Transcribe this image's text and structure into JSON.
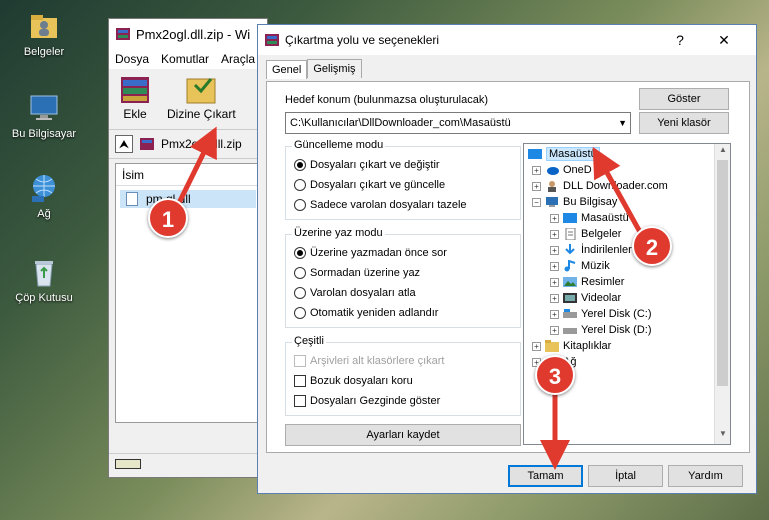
{
  "desktop": {
    "icons": [
      {
        "label": "Belgeler",
        "icon": "folder-user-icon"
      },
      {
        "label": "Bu Bilgisayar",
        "icon": "computer-icon"
      },
      {
        "label": "Ağ",
        "icon": "network-icon"
      },
      {
        "label": "Çöp Kutusu",
        "icon": "recycle-bin-icon"
      }
    ]
  },
  "winrar": {
    "title": "Pmx2ogl.dll.zip - Wi",
    "menu": [
      "Dosya",
      "Komutlar",
      "Araçla"
    ],
    "toolbar": {
      "add_label": "Ekle",
      "extract_label": "Dizine Çıkart"
    },
    "path": "Pmx2ogl.dll.zip",
    "column_name": "İsim",
    "file": "pmx2ogl.dll",
    "file_visible": "pm    gl.dll"
  },
  "dialog": {
    "title": "Çıkartma yolu ve seçenekleri",
    "help": "?",
    "close": "✕",
    "tabs": [
      "Genel",
      "Gelişmiş"
    ],
    "dest_label": "Hedef konum (bulunmazsa oluşturulacak)",
    "dest_value": "C:\\Kullanıcılar\\DllDownloader_com\\Masaüstü",
    "show_button": "Göster",
    "new_folder_button": "Yeni klasör",
    "update_mode": {
      "title": "Güncelleme modu",
      "options": [
        "Dosyaları çıkart ve değiştir",
        "Dosyaları çıkart ve güncelle",
        "Sadece varolan dosyaları tazele"
      ],
      "selected": 0
    },
    "overwrite_mode": {
      "title": "Üzerine yaz modu",
      "options": [
        "Üzerine yazmadan önce sor",
        "Sormadan üzerine yaz",
        "Varolan dosyaları atla",
        "Otomatik yeniden adlandır"
      ],
      "selected": 0
    },
    "misc": {
      "title": "Çeşitli",
      "options": [
        "Arşivleri alt klasörlere çıkart",
        "Bozuk dosyaları koru",
        "Dosyaları Gezginde göster"
      ]
    },
    "save_settings": "Ayarları kaydet",
    "tree": [
      {
        "label": "Masaüstü",
        "icon": "desktop-folder-icon",
        "level": 0,
        "selected": true
      },
      {
        "label": "OneD",
        "icon": "onedrive-icon",
        "level": 1
      },
      {
        "label": "DLL Downloader.com",
        "icon": "user-icon",
        "level": 1
      },
      {
        "label": "Bu Bilgisay",
        "icon": "computer-icon",
        "level": 1,
        "expanded": true
      },
      {
        "label": "Masaüstü",
        "icon": "desktop-folder-icon",
        "level": 2
      },
      {
        "label": "Belgeler",
        "icon": "documents-icon",
        "level": 2
      },
      {
        "label": "İndirilenler",
        "icon": "downloads-icon",
        "level": 2
      },
      {
        "label": "Müzik",
        "icon": "music-icon",
        "level": 2
      },
      {
        "label": "Resimler",
        "icon": "pictures-icon",
        "level": 2
      },
      {
        "label": "Videolar",
        "icon": "videos-icon",
        "level": 2
      },
      {
        "label": "Yerel Disk (C:)",
        "icon": "drive-icon",
        "level": 2
      },
      {
        "label": "Yerel Disk (D:)",
        "icon": "drive-icon",
        "level": 2
      },
      {
        "label": "Kitaplıklar",
        "icon": "libraries-icon",
        "level": 1
      },
      {
        "label": "Ağ",
        "icon": "network-icon",
        "level": 1
      }
    ],
    "ok_button": "Tamam",
    "cancel_button": "İptal",
    "help_button": "Yardım"
  },
  "markers": [
    "1",
    "2",
    "3"
  ],
  "colors": {
    "marker": "#e03a2f",
    "selection": "#cce8ff",
    "accent": "#0078d7"
  }
}
